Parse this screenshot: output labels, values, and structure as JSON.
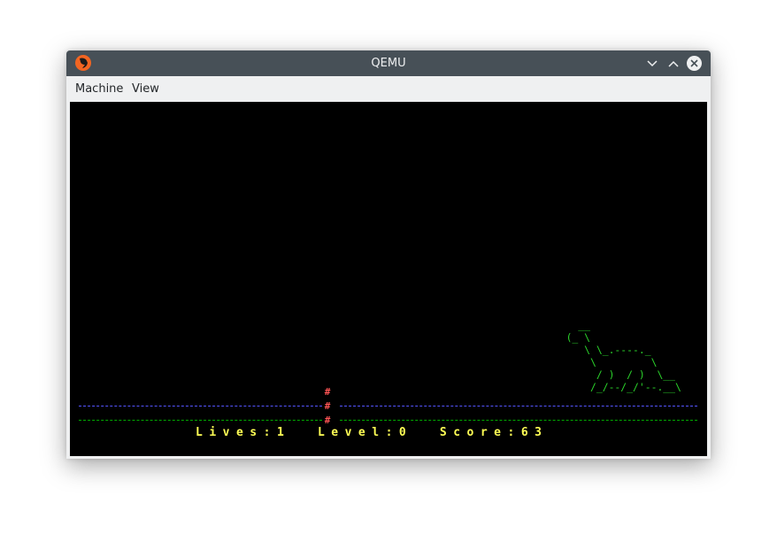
{
  "window": {
    "title": "QEMU"
  },
  "menubar": {
    "items": [
      {
        "label": "Machine"
      },
      {
        "label": "View"
      }
    ]
  },
  "game": {
    "background": "#000000",
    "dino_art": "     __\n   (_ \\\n      \\ \\_.----._\n       \\         \\\n        / )  / )  \\__\n       /_/--/_/'--.__\\",
    "obstacle_glyph": "#",
    "status_line": "Lives:1  Level:0  Score:63",
    "lives": 1,
    "level": 0,
    "score": 63,
    "colors": {
      "dino": "#2bd42b",
      "obstacle": "#ff5555",
      "ground_top": "#5555ff",
      "ground_bottom": "#00aa00",
      "status": "#ffff55"
    }
  },
  "icons": {
    "app": "qemu-logo-icon",
    "minimize": "chevron-down-icon",
    "maximize": "chevron-up-icon",
    "close": "close-icon"
  }
}
